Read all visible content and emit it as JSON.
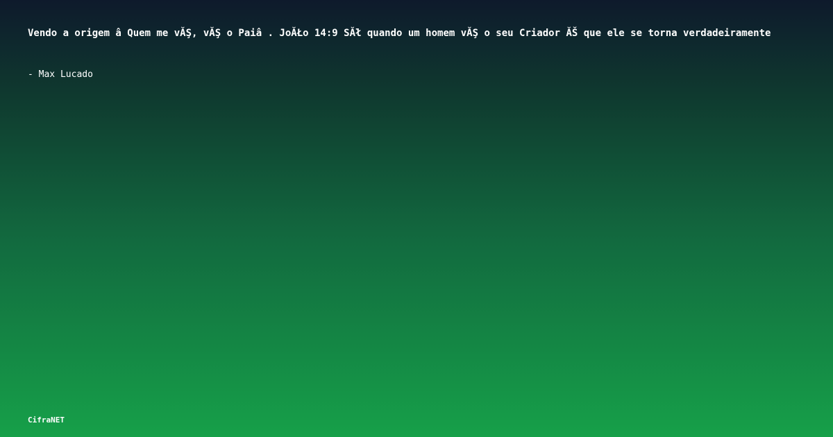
{
  "quote": {
    "text": "Vendo a origem â  Quem me vĂŞ, vĂŞ o Paiâ  . JoĂŁo 14:9 SĂł quando um homem vĂŞ o seu Criador ĂŠ que ele se torna verdadeiramente",
    "author": "- Max Lucado"
  },
  "brand": {
    "name": "CifraNET"
  },
  "colors": {
    "gradient_top": "#0e1a2c",
    "gradient_bottom": "#16a049",
    "text": "#ffffff"
  }
}
